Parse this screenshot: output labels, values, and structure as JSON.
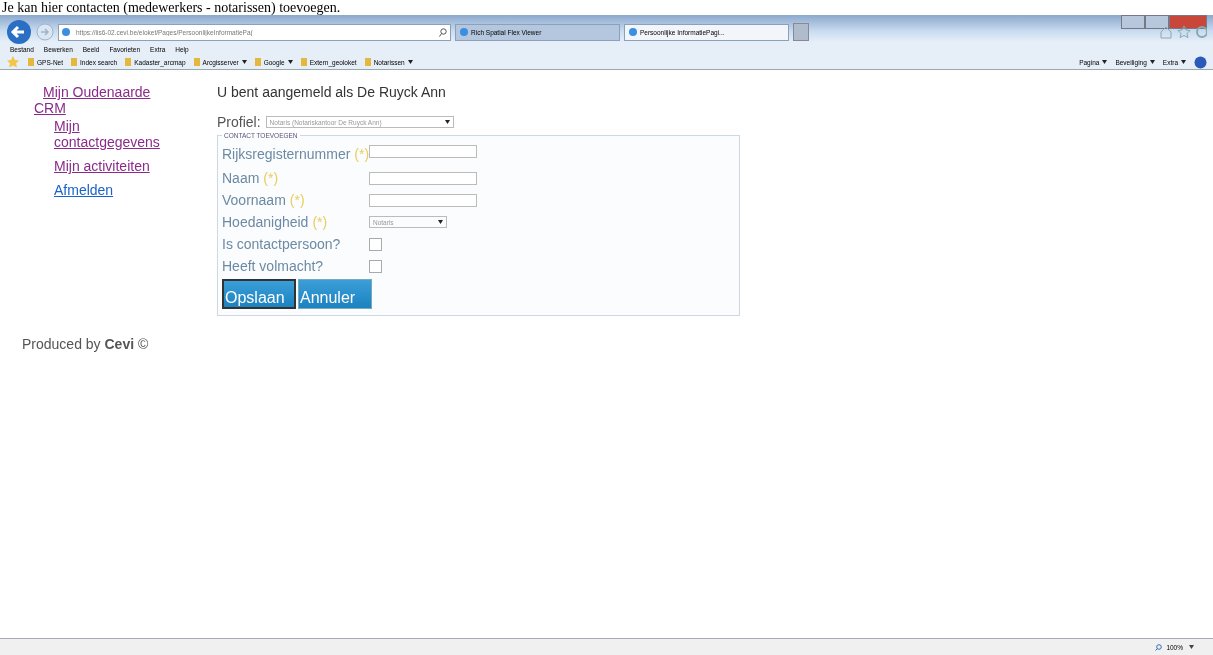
{
  "caption": "Je kan hier contacten (medewerkers - notarissen) toevoegen.",
  "browser": {
    "address": "https://iis6-02.cevi.be/eloket/Pages/PersoonlijkeInformatiePa(",
    "tabs": [
      {
        "label": "Rich Spatial Flex Viewer",
        "selected": false
      },
      {
        "label": "Persoonlijke InformatiePagi...",
        "selected": true
      }
    ],
    "menu": [
      "Bestand",
      "Bewerken",
      "Beeld",
      "Favorieten",
      "Extra",
      "Help"
    ],
    "favorites": [
      {
        "label": "GPS-Net",
        "dropdown": false
      },
      {
        "label": "Index search",
        "dropdown": false
      },
      {
        "label": "Kadaster_arcmap",
        "dropdown": false
      },
      {
        "label": "Arcgisserver",
        "dropdown": true
      },
      {
        "label": "Google",
        "dropdown": true
      },
      {
        "label": "Extern_geoloket",
        "dropdown": false
      },
      {
        "label": "Notarissen",
        "dropdown": true
      }
    ],
    "commands": [
      "Pagina",
      "Beveiliging",
      "Extra"
    ]
  },
  "nav": [
    {
      "label": "Mijn Oudenaarde CRM",
      "visited": true,
      "children": [
        {
          "label": "Mijn contactgegevens",
          "visited": true
        },
        {
          "label": "Mijn activiteiten",
          "visited": true
        },
        {
          "label": "Afmelden",
          "visited": false
        }
      ]
    }
  ],
  "login_text": "U bent aangemeld als De Ruyck Ann",
  "profile": {
    "label": "Profiel:",
    "value": "Notaris (Notariskantoor De Ruyck Ann)"
  },
  "form": {
    "legend": "CONTACT TOEVOEGEN",
    "fields": [
      {
        "kind": "text",
        "label": "Rijksregisternummer",
        "required": "(*)"
      },
      {
        "kind": "text",
        "label": "Naam",
        "required": "(*)"
      },
      {
        "kind": "text",
        "label": "Voornaam",
        "required": "(*)"
      },
      {
        "kind": "select",
        "label": "Hoedanigheid",
        "required": "(*)",
        "value": "Notaris"
      },
      {
        "kind": "checkbox",
        "label": "Is contactpersoon?",
        "checked": false
      },
      {
        "kind": "checkbox",
        "label": "Heeft volmacht?",
        "checked": false
      }
    ],
    "buttons": [
      {
        "label": "Opslaan",
        "focused": true
      },
      {
        "label": "Annuler",
        "focused": false
      }
    ]
  },
  "footer": "Produced by **Cevi** ©",
  "status_bar": {
    "zoom": "100%"
  }
}
